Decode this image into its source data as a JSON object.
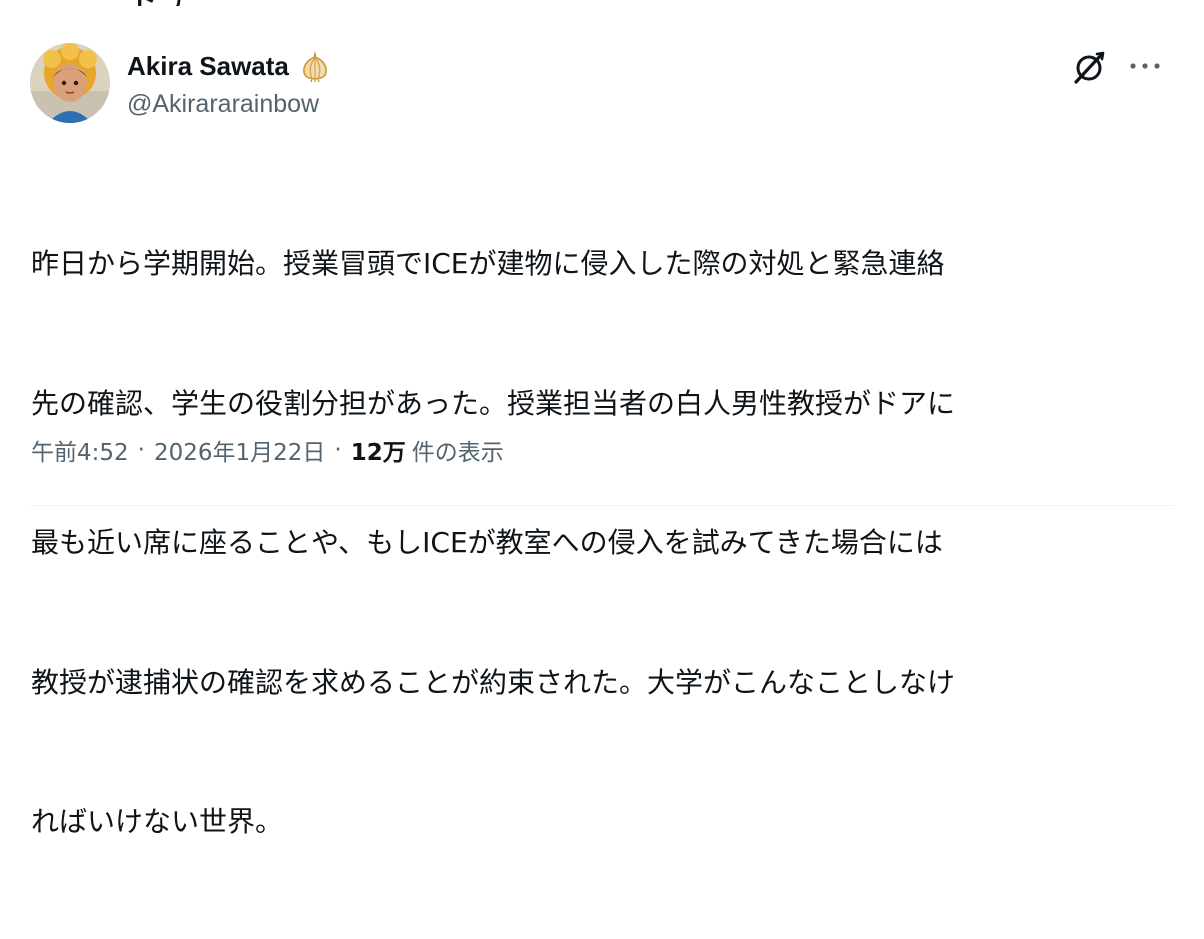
{
  "previous_header_fragment": "ド ﾃ",
  "author": {
    "display_name": "Akira Sawata",
    "handle": "@Akirararainbow",
    "badge_icon": "onion-icon"
  },
  "actions": {
    "grok_icon": "grok-icon",
    "more_icon": "more-icon",
    "more_label": "···"
  },
  "tweet": {
    "lines": [
      "昨日から学期開始。授業冒頭でICEが建物に侵入した際の対処と緊急連絡",
      "先の確認、学生の役割分担があった。授業担当者の白人男性教授がドアに",
      "最も近い席に座ることや、もしICEが教室への侵入を試みてきた場合には",
      "教授が逮捕状の確認を求めることが約束された。大学がこんなことしなけ",
      "ればいけない世界。"
    ]
  },
  "meta": {
    "time": "午前4:52",
    "separator": "·",
    "date": "2026年1月22日",
    "views_count": "12万",
    "views_label": "件の表示"
  },
  "colors": {
    "text_primary": "#0f1419",
    "text_secondary": "#536471",
    "divider": "#eff3f4"
  }
}
